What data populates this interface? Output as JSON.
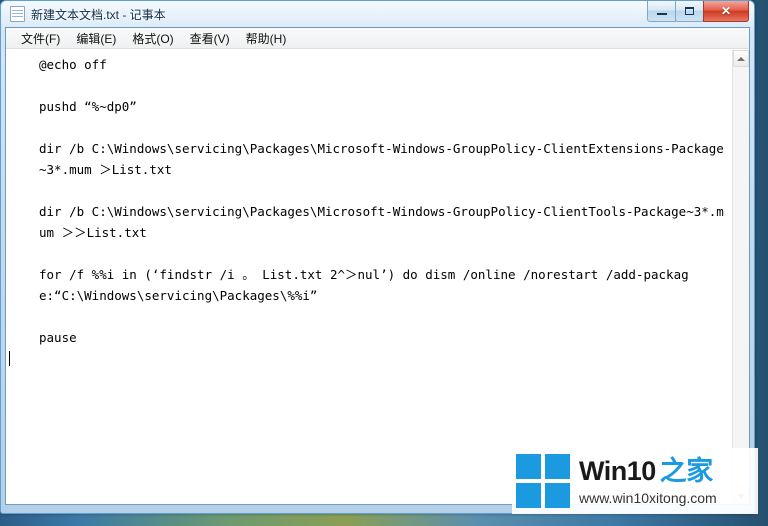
{
  "window": {
    "title": "新建文本文档.txt - 记事本",
    "icon": "notepad-document-icon",
    "controls": {
      "minimize": "─",
      "maximize": "□",
      "close": "✕"
    }
  },
  "menubar": {
    "items": [
      {
        "label": "文件(F)"
      },
      {
        "label": "编辑(E)"
      },
      {
        "label": "格式(O)"
      },
      {
        "label": "查看(V)"
      },
      {
        "label": "帮助(H)"
      }
    ]
  },
  "editor": {
    "lines": [
      "@echo off",
      "",
      "pushd “%~dp0”",
      "",
      "dir /b C:\\Windows\\servicing\\Packages\\Microsoft-Windows-GroupPolicy-ClientExtensions-Package~3*.mum ＞List.txt",
      "",
      "dir /b C:\\Windows\\servicing\\Packages\\Microsoft-Windows-GroupPolicy-ClientTools-Package~3*.mum ＞＞List.txt",
      "",
      "for /f %%i in (‘findstr /i 。 List.txt 2^＞nul’) do dism /online /norestart /add-package:“C:\\Windows\\servicing\\Packages\\%%i”",
      "",
      "pause",
      ""
    ],
    "caret_line_index": 11
  },
  "scrollbar": {
    "up_arrow": "scroll-up-arrow-icon",
    "down_arrow": "scroll-down-arrow-icon"
  },
  "watermark": {
    "brand": "Win10",
    "brand_cn": "之家",
    "url": "www.win10xitong.com",
    "logo": "windows-logo-icon",
    "accent_color": "#1c9ae0"
  }
}
